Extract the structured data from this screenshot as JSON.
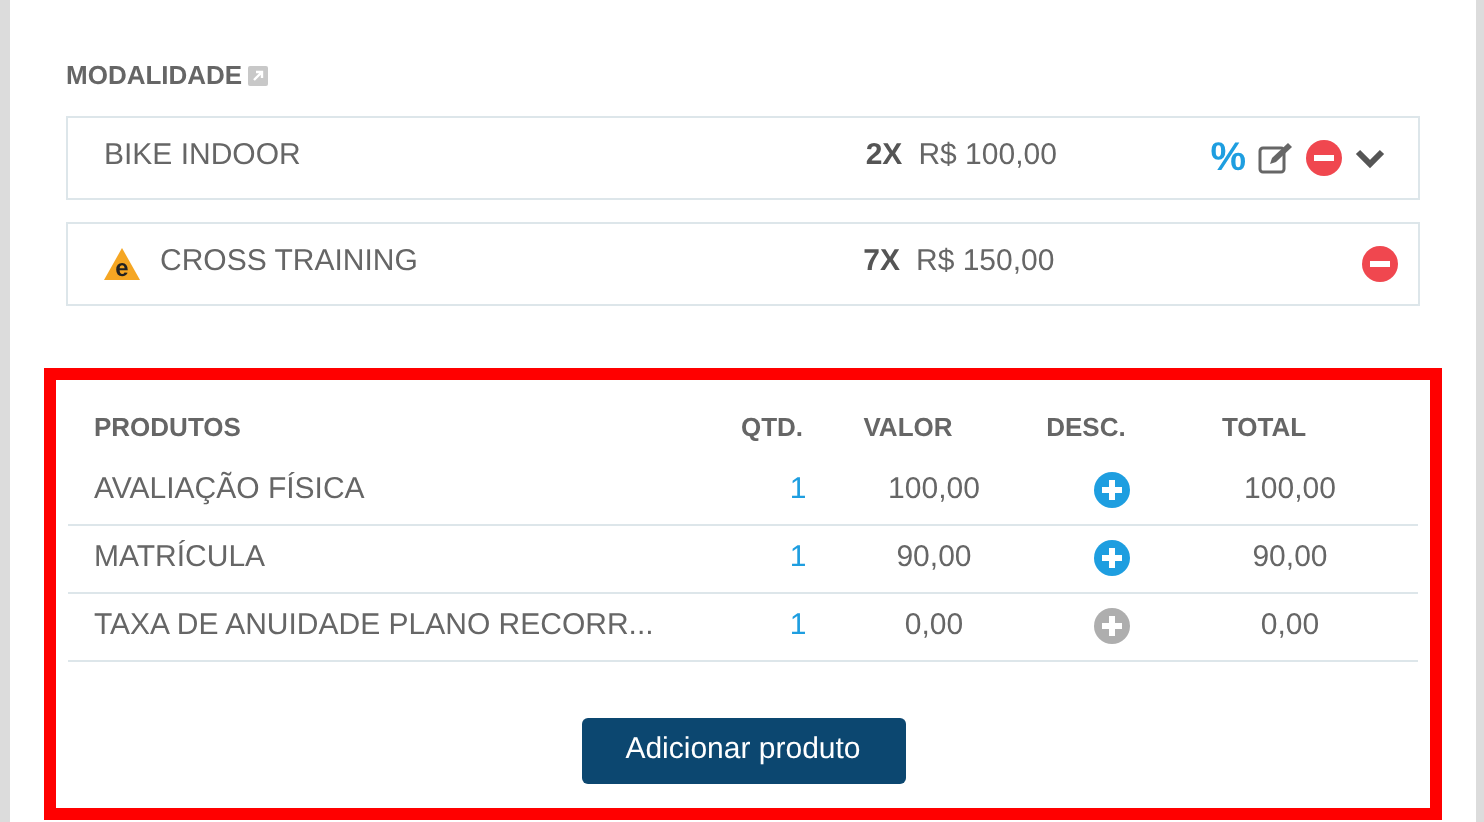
{
  "modalidade": {
    "title": "MODALIDADE",
    "items": [
      {
        "kind": "editable",
        "name": "BIKE INDOOR",
        "times": "2X",
        "price": "R$ 100,00",
        "discount_symbol": "%"
      },
      {
        "kind": "removable",
        "badge": "e",
        "name": "CROSS TRAINING",
        "times": "7X",
        "price": "R$ 150,00"
      }
    ]
  },
  "produtos": {
    "columns": [
      "PRODUTOS",
      "QTD.",
      "VALOR",
      "DESC.",
      "TOTAL"
    ],
    "rows": [
      {
        "name": "AVALIAÇÃO FÍSICA",
        "qty": "1",
        "value": "100,00",
        "discount_enabled": true,
        "total": "100,00"
      },
      {
        "name": "MATRÍCULA",
        "qty": "1",
        "value": "90,00",
        "discount_enabled": true,
        "total": "90,00"
      },
      {
        "name": "TAXA DE ANUIDADE PLANO RECORR...",
        "qty": "1",
        "value": "0,00",
        "discount_enabled": false,
        "total": "0,00"
      }
    ],
    "add_button": "Adicionar produto"
  }
}
